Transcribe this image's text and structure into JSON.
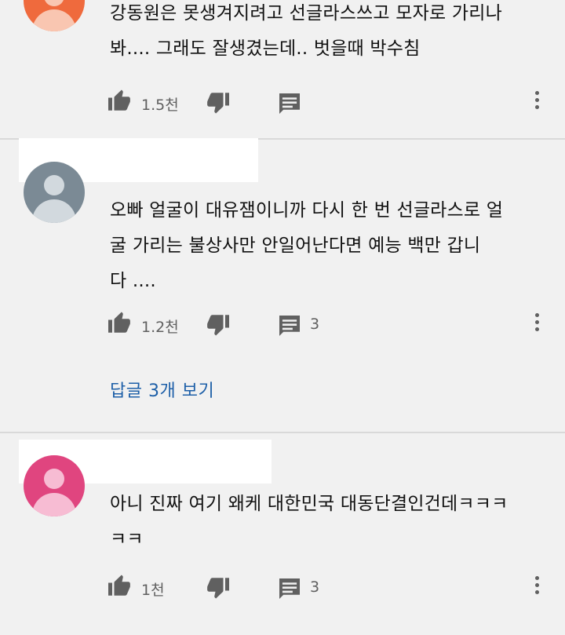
{
  "comments": [
    {
      "text": "강동원은 못생겨지려고 선글라스쓰고 모자로 가리나\n봐.... 그래도 잘생겼는데.. 벗을때 박수침",
      "likes": "1.5천",
      "replies_count": "",
      "avatar_color": "#ef6a3d",
      "avatar_fg": "#f9c6b1"
    },
    {
      "text": "오빠 얼굴이 대유잼이니까 다시 한 번 선글라스로 얼\n굴 가리는 불상사만 안일어난다면 예능 백만 갑니\n다 ....",
      "likes": "1.2천",
      "replies_count": "3",
      "view_replies": "답글 3개 보기",
      "avatar_color": "#7b8a95",
      "avatar_fg": "#d2d9de"
    },
    {
      "text": "아니 진짜 여기 왜케 대한민국 대동단결인건데ㅋㅋㅋ\nㅋㅋ",
      "likes": "1천",
      "replies_count": "3",
      "avatar_color": "#e0457f",
      "avatar_fg": "#f7bcd3"
    }
  ],
  "icons": {
    "like": "thumbs-up-icon",
    "dislike": "thumbs-down-icon",
    "reply": "comment-icon",
    "more": "more-vert-icon"
  },
  "colors": {
    "background": "#f1f1f1",
    "link": "#1d5fa8",
    "icon": "#606060"
  }
}
